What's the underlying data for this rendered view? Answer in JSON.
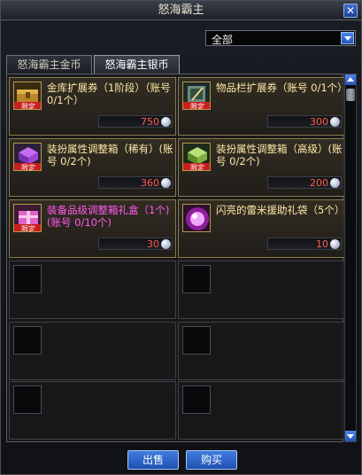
{
  "window": {
    "title": "怒海霸主"
  },
  "filter": {
    "selected": "全部"
  },
  "tabs": [
    {
      "label": "怒海霸主金币",
      "active": false
    },
    {
      "label": "怒海霸主银币",
      "active": true
    }
  ],
  "items": [
    {
      "name": "金库扩展券（1阶段）（账号 0/1个）",
      "price": "750",
      "badge": "限定",
      "icon": "gold-chest-icon",
      "highlight": false
    },
    {
      "name": "物品栏扩展券（账号 0/1个）",
      "price": "300",
      "badge": "限定",
      "icon": "inventory-expand-icon",
      "highlight": false
    },
    {
      "name": "装扮属性调整箱（稀有）(账号 0/2个)",
      "price": "360",
      "badge": "限定",
      "icon": "purple-box-icon",
      "highlight": false
    },
    {
      "name": "装扮属性调整箱（高级）(账号 0/2个)",
      "price": "200",
      "badge": "限定",
      "icon": "green-box-icon",
      "highlight": false
    },
    {
      "name": "装备品级调整箱礼盒（1个)(账号 0/10个)",
      "price": "30",
      "badge": "限定",
      "icon": "pink-gift-box-icon",
      "highlight": true
    },
    {
      "name": "闪亮的雷米援助礼袋（5个）",
      "price": "10",
      "badge": "",
      "icon": "glowing-bag-icon",
      "highlight": false
    }
  ],
  "buttons": {
    "sell": "出售",
    "buy": "购买"
  },
  "colors": {
    "price": "#ff5a4a",
    "item_name": "#ffe9a6",
    "item_name_highlight": "#ff5af0",
    "accent_blue": "#2f6ad0"
  }
}
